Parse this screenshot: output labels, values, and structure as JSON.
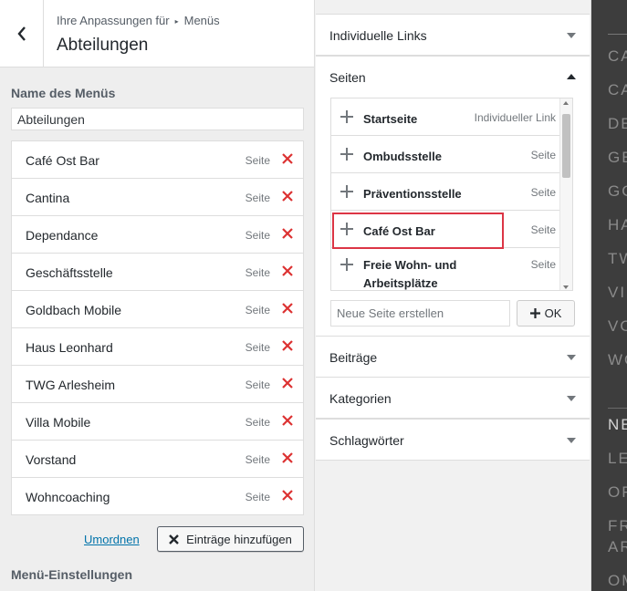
{
  "header": {
    "breadcrumb_prefix": "Ihre Anpassungen für",
    "breadcrumb_section": "Menüs",
    "title": "Abteilungen"
  },
  "menu_name": {
    "label": "Name des Menüs",
    "value": "Abteilungen"
  },
  "menu_items": [
    {
      "title": "Café Ost Bar",
      "type": "Seite"
    },
    {
      "title": "Cantina",
      "type": "Seite"
    },
    {
      "title": "Dependance",
      "type": "Seite"
    },
    {
      "title": "Geschäftsstelle",
      "type": "Seite"
    },
    {
      "title": "Goldbach Mobile",
      "type": "Seite"
    },
    {
      "title": "Haus Leonhard",
      "type": "Seite"
    },
    {
      "title": "TWG Arlesheim",
      "type": "Seite"
    },
    {
      "title": "Villa Mobile",
      "type": "Seite"
    },
    {
      "title": "Vorstand",
      "type": "Seite"
    },
    {
      "title": "Wohncoaching",
      "type": "Seite"
    }
  ],
  "actions": {
    "reorder": "Umordnen",
    "add_items": "Einträge hinzufügen"
  },
  "menu_settings_heading": "Menü-Einstellungen",
  "available": {
    "custom_links": "Individuelle Links",
    "pages": {
      "title": "Seiten",
      "items": [
        {
          "title": "Startseite",
          "type": "Individueller Link"
        },
        {
          "title": "Ombudsstelle",
          "type": "Seite"
        },
        {
          "title": "Präventionsstelle",
          "type": "Seite"
        },
        {
          "title": "Café Ost Bar",
          "type": "Seite"
        },
        {
          "title": "Freie Wohn- und Arbeitsplätze",
          "type": "Seite"
        }
      ],
      "new_page_placeholder": "Neue Seite erstellen",
      "ok_label": "OK"
    },
    "posts": "Beiträge",
    "categories": "Kategorien",
    "tags": "Schlagwörter"
  },
  "preview": {
    "words": [
      "CA",
      "CA",
      "DE",
      "GE",
      "GO",
      "HA",
      "TW",
      "VI",
      "VO",
      "WO",
      "NE",
      "LE",
      "OF",
      "FR",
      "AR",
      "OM"
    ]
  },
  "colors": {
    "remove_icon": "#dc3232",
    "link": "#0073aa",
    "highlight_border": "#dc3545",
    "preview_bg": "#3d3d3d"
  }
}
